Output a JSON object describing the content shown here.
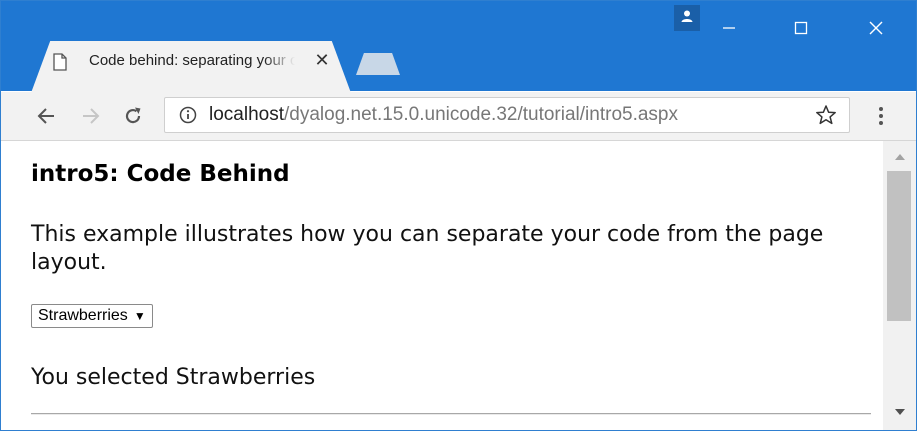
{
  "browser": {
    "tab": {
      "title": "Code behind: separating your code from the page layout",
      "close_glyph": "✕",
      "favicon": "page-icon"
    },
    "window_controls": {
      "minimize": "—",
      "maximize": "☐",
      "close": "✕"
    },
    "address": {
      "host": "localhost",
      "path": "/dyalog.net.15.0.unicode.32/tutorial/intro5.aspx"
    },
    "accent_color": "#1f77d2"
  },
  "page": {
    "title": "intro5: Code Behind",
    "description": "This example illustrates how you can separate your code from the page layout.",
    "select": {
      "selected": "Strawberries",
      "arrow": "▼"
    },
    "result": "You selected Strawberries"
  }
}
